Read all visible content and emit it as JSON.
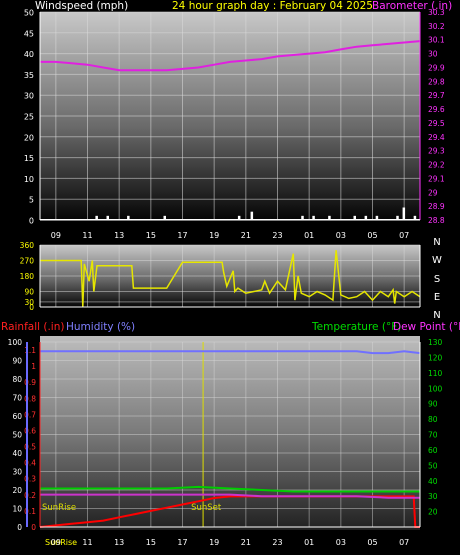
{
  "chart_data": [
    {
      "type": "line",
      "panel": "wind-barometer",
      "title": "24 hour graph day : February 04 2025",
      "left_axis_label": "Windspeed (mph)",
      "right_axis_label": "Barometer (.in)",
      "ylim_left": [
        0,
        50
      ],
      "left_ticks": [
        "0",
        "5",
        "10",
        "15",
        "20",
        "25",
        "30",
        "35",
        "40",
        "45",
        "50"
      ],
      "ylim_right": [
        28.8,
        30.3
      ],
      "right_ticks": [
        "28.8",
        "28.9",
        "29",
        "29.1",
        "29.2",
        "29.3",
        "29.4",
        "29.5",
        "29.6",
        "29.7",
        "29.8",
        "29.9",
        "30",
        "30.1",
        "30.2",
        "30.3"
      ],
      "x_tick_labels": [
        "09",
        "11",
        "13",
        "15",
        "17",
        "19",
        "21",
        "23",
        "01",
        "03",
        "05",
        "07"
      ],
      "grid": true,
      "colors": {
        "title": "#ffff00",
        "left_axis": "#ffffff",
        "right_axis": "#ff33ff",
        "windspeed": "#ffffff",
        "barometer": "#e020e0"
      },
      "series": [
        {
          "name": "Barometer (.in)",
          "axis": "right",
          "x": [
            0,
            1,
            2,
            3,
            4,
            5,
            6,
            7,
            8,
            9,
            10,
            11,
            12,
            13,
            14,
            15,
            16,
            17,
            18,
            19,
            20,
            21,
            22,
            23,
            24
          ],
          "values": [
            29.94,
            29.94,
            29.93,
            29.92,
            29.9,
            29.88,
            29.88,
            29.88,
            29.88,
            29.89,
            29.9,
            29.92,
            29.94,
            29.95,
            29.96,
            29.98,
            29.99,
            30.0,
            30.01,
            30.03,
            30.05,
            30.06,
            30.07,
            30.08,
            30.09
          ]
        },
        {
          "name": "Windspeed (mph)",
          "axis": "left",
          "x": [
            0,
            2,
            3.5,
            4.2,
            5.5,
            7.8,
            12.5,
            13.3,
            16.5,
            17.2,
            18.2,
            19.8,
            20.5,
            21.2,
            22.5,
            22.9,
            23.6
          ],
          "values": [
            0,
            0,
            1,
            1,
            1,
            1,
            1,
            2,
            1,
            1,
            1,
            1,
            1,
            1,
            1,
            3,
            1
          ]
        }
      ]
    },
    {
      "type": "line",
      "panel": "wind-direction",
      "ylim": [
        0,
        360
      ],
      "left_ticks": [
        "0",
        "30",
        "90",
        "180",
        "270",
        "360"
      ],
      "right_labels": [
        "N",
        "W",
        "S",
        "E",
        "N"
      ],
      "colors": {
        "direction": "#e6e600"
      },
      "series": [
        {
          "name": "Wind direction (deg)",
          "x": [
            0,
            2.6,
            2.7,
            2.8,
            3.1,
            3.3,
            3.4,
            3.6,
            4.0,
            5.0,
            5.8,
            5.9,
            8.0,
            9.0,
            11.5,
            11.6,
            11.8,
            12.2,
            12.3,
            12.5,
            13.0,
            13.5,
            14.0,
            14.2,
            14.5,
            15.0,
            15.5,
            16.0,
            16.1,
            16.3,
            16.5,
            17.0,
            17.5,
            18.0,
            18.5,
            18.7,
            19.0,
            19.5,
            20.0,
            20.5,
            21.0,
            21.5,
            22.0,
            22.3,
            22.4,
            22.5,
            23.0,
            23.5,
            24.0
          ],
          "values": [
            270,
            270,
            0,
            250,
            150,
            270,
            90,
            240,
            240,
            240,
            240,
            110,
            110,
            260,
            260,
            200,
            120,
            210,
            90,
            110,
            80,
            90,
            100,
            150,
            80,
            150,
            100,
            310,
            40,
            180,
            80,
            60,
            90,
            70,
            40,
            330,
            70,
            50,
            60,
            90,
            40,
            90,
            60,
            100,
            20,
            90,
            60,
            90,
            60
          ]
        }
      ]
    },
    {
      "type": "line",
      "panel": "rain-humidity-temperature",
      "left_axis_label_rain": "Rainfall (.in)",
      "left_axis_label_humidity": "Humidity (%)",
      "right_axis_label_temperature": "Temperature (°F)",
      "right_axis_label_dewpoint": "Dew Point (°F)",
      "ylim_rain": [
        0,
        1.15
      ],
      "rain_ticks": [
        "0",
        "0.1",
        "0.2",
        "0.3",
        "0.4",
        "0.5",
        "0.6",
        "0.7",
        "0.8",
        "0.9",
        "1",
        "1.1"
      ],
      "ylim_humidity": [
        0,
        100
      ],
      "humidity_ticks": [
        "0",
        "10",
        "20",
        "30",
        "40",
        "50",
        "60",
        "70",
        "80",
        "90",
        "100"
      ],
      "ylim_temperature": [
        10,
        130
      ],
      "temperature_ticks": [
        "20",
        "30",
        "40",
        "50",
        "60",
        "70",
        "80",
        "90",
        "100",
        "110",
        "120",
        "130"
      ],
      "x_tick_labels": [
        "SunRise",
        "09",
        "11",
        "13",
        "15",
        "17",
        "19",
        "21",
        "23",
        "01",
        "03",
        "05",
        "07"
      ],
      "annotations": [
        {
          "text": "SunRise",
          "x": 0.5
        },
        {
          "text": "SunSet",
          "x": 10.3
        }
      ],
      "colors": {
        "rain": "#ff0000",
        "humidity": "#7070ff",
        "temperature": "#00cc00",
        "dewpoint": "#cc33cc",
        "sunmarker": "#dddd00"
      },
      "series": [
        {
          "name": "Rainfall (.in)",
          "axis": "rain",
          "x": [
            0,
            1,
            2,
            3,
            4,
            5,
            6,
            7,
            8,
            9,
            10,
            11,
            12,
            13,
            14,
            15,
            16,
            17,
            18,
            19,
            20,
            21,
            22,
            23,
            23.6,
            23.7,
            24
          ],
          "values": [
            0,
            0.01,
            0.02,
            0.03,
            0.04,
            0.06,
            0.08,
            0.1,
            0.12,
            0.14,
            0.16,
            0.18,
            0.19,
            0.19,
            0.19,
            0.19,
            0.19,
            0.19,
            0.19,
            0.19,
            0.19,
            0.19,
            0.19,
            0.19,
            0.19,
            0.0,
            0.0
          ]
        },
        {
          "name": "Humidity (%)",
          "axis": "humidity",
          "x": [
            0,
            4,
            8,
            12,
            16,
            20,
            21,
            22,
            23,
            24
          ],
          "values": [
            95,
            95,
            95,
            95,
            95,
            95,
            94,
            94,
            95,
            94
          ]
        },
        {
          "name": "Temperature (°F)",
          "axis": "temperature",
          "x": [
            0,
            2,
            4,
            6,
            8,
            10,
            12,
            14,
            16,
            18,
            20,
            22,
            24
          ],
          "values": [
            35,
            35,
            35,
            35,
            35,
            36,
            35,
            34,
            33,
            33,
            33,
            33,
            33
          ]
        },
        {
          "name": "Dew Point (°F)",
          "axis": "temperature",
          "x": [
            0,
            2,
            4,
            6,
            8,
            10,
            12,
            14,
            16,
            18,
            20,
            22,
            24
          ],
          "values": [
            31,
            31,
            31,
            31,
            31,
            31,
            31,
            30,
            30,
            30,
            30,
            29,
            29
          ]
        }
      ]
    }
  ]
}
